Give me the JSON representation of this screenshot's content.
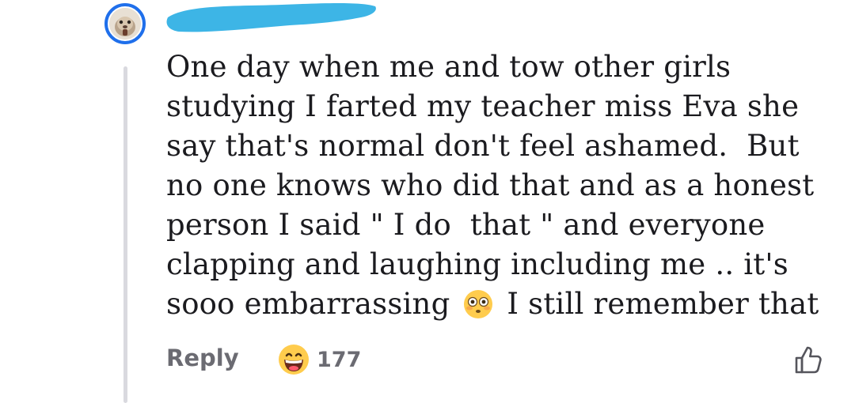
{
  "comment": {
    "lines": [
      "One day when me and tow other girls",
      "studying I farted my teacher miss Eva she",
      "say that's normal don't feel ashamed.  But",
      "no one knows who did that and as a honest",
      "person I said \" I do  that \" and everyone",
      "clapping and laughing including me .. it's"
    ],
    "last_line_before_emoji": "sooo embarrassing",
    "last_line_after_emoji": " I still remember that",
    "inline_emoji": "flushed-face-emoji"
  },
  "actions": {
    "reply_label": "Reply",
    "reaction_emoji": "grinning-face-emoji",
    "reaction_count": "177",
    "like_icon": "thumbs-up-outline-icon"
  },
  "colors": {
    "avatar_ring": "#1f6feb",
    "redaction": "#3db5e6",
    "thread_line": "#d9d9df",
    "text": "#1b1b1f",
    "muted": "#6b6b72"
  }
}
